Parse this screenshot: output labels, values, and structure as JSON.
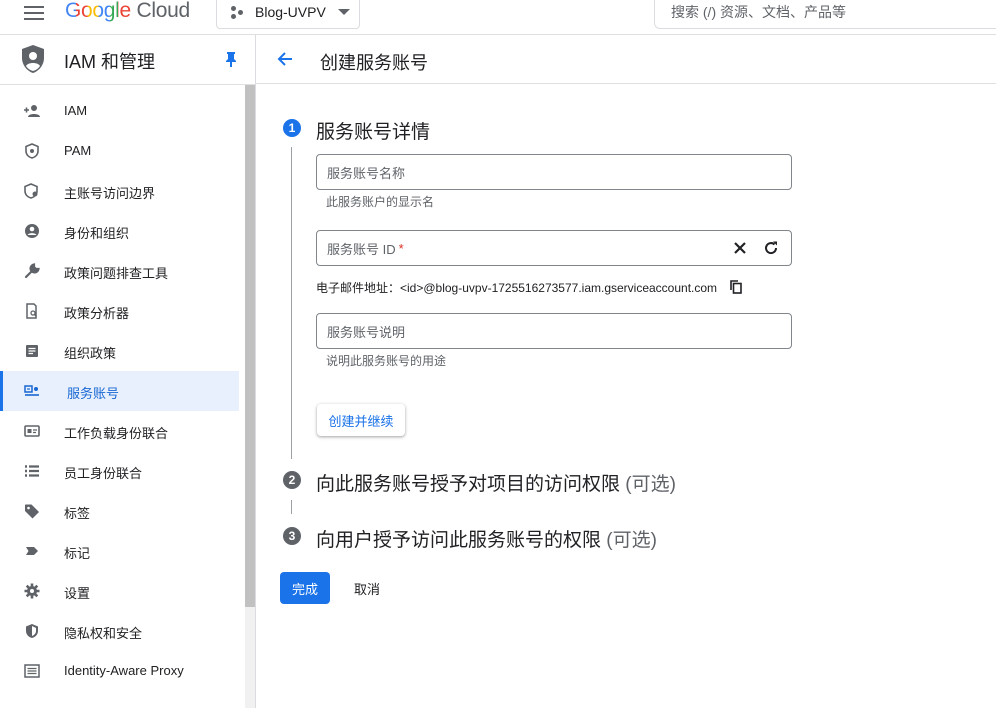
{
  "topbar": {
    "logo_google": "Google",
    "logo_cloud": "Cloud",
    "project_name": "Blog-UVPV",
    "search_placeholder": "搜索 (/) 资源、文档、产品等"
  },
  "sidebar": {
    "title": "IAM 和管理",
    "items": [
      {
        "label": "IAM",
        "icon": "person-add-icon",
        "active": false
      },
      {
        "label": "PAM",
        "icon": "shield-icon",
        "active": false
      },
      {
        "label": "主账号访问边界",
        "icon": "policy-shield-icon",
        "active": false
      },
      {
        "label": "身份和组织",
        "icon": "account-circle-icon",
        "active": false
      },
      {
        "label": "政策问题排查工具",
        "icon": "wrench-icon",
        "active": false
      },
      {
        "label": "政策分析器",
        "icon": "document-search-icon",
        "active": false
      },
      {
        "label": "组织政策",
        "icon": "list-document-icon",
        "active": false
      },
      {
        "label": "服务账号",
        "icon": "service-account-icon",
        "active": true
      },
      {
        "label": "工作负载身份联合",
        "icon": "id-card-icon",
        "active": false
      },
      {
        "label": "员工身份联合",
        "icon": "list-icon",
        "active": false
      },
      {
        "label": "标签",
        "icon": "tag-icon",
        "active": false
      },
      {
        "label": "标记",
        "icon": "label-icon",
        "active": false
      },
      {
        "label": "设置",
        "icon": "gear-icon",
        "active": false
      },
      {
        "label": "隐私权和安全",
        "icon": "security-shield-icon",
        "active": false
      },
      {
        "label": "Identity-Aware Proxy",
        "icon": "proxy-icon",
        "active": false
      }
    ]
  },
  "main": {
    "title": "创建服务账号",
    "steps": [
      {
        "number": "1",
        "title": "服务账号详情",
        "optional": ""
      },
      {
        "number": "2",
        "title": "向此服务账号授予对项目的访问权限",
        "optional": "(可选)"
      },
      {
        "number": "3",
        "title": "向用户授予访问此服务账号的权限",
        "optional": "(可选)"
      }
    ],
    "fields": {
      "name_placeholder": "服务账号名称",
      "name_helper": "此服务账户的显示名",
      "id_placeholder": "服务账号 ID",
      "id_required_mark": "*",
      "email_line": "电子邮件地址：<id>@blog-uvpv-1725516273577.iam.gserviceaccount.com",
      "desc_placeholder": "服务账号说明",
      "desc_helper": "说明此服务账号的用途"
    },
    "create_button": "创建并继续",
    "done_button": "完成",
    "cancel_button": "取消"
  },
  "colors": {
    "accent": "#1a73e8",
    "step_active": "#1a73e8",
    "step_inactive": "#5f6368"
  }
}
